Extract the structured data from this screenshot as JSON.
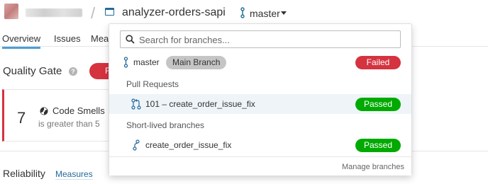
{
  "header": {
    "project_title": "analyzer-orders-sapi",
    "current_branch": "master",
    "separator": "/"
  },
  "nav": {
    "tabs": [
      "Overview",
      "Issues",
      "Mea"
    ]
  },
  "page": {
    "quality_gate_label": "Quality Gate",
    "quality_gate_status": "Failed",
    "condition": {
      "value": "7",
      "metric": "Code Smells",
      "detail": "is greater than 5"
    },
    "reliability_label": "Reliability",
    "measures_link": "Measures"
  },
  "dropdown": {
    "search_placeholder": "Search for branches...",
    "main_branch": {
      "name": "master",
      "badge": "Main Branch",
      "status": "Failed"
    },
    "pull_requests_heading": "Pull Requests",
    "pull_requests": [
      {
        "label": "101 – create_order_issue_fix",
        "status": "Passed"
      }
    ],
    "short_lived_heading": "Short-lived branches",
    "short_lived": [
      {
        "label": "create_order_issue_fix",
        "status": "Passed"
      }
    ],
    "manage_link": "Manage branches"
  },
  "colors": {
    "failed": "#d4333f",
    "passed": "#00aa00",
    "accent_blue": "#236a97",
    "tab_underline": "#4b9fd5"
  }
}
